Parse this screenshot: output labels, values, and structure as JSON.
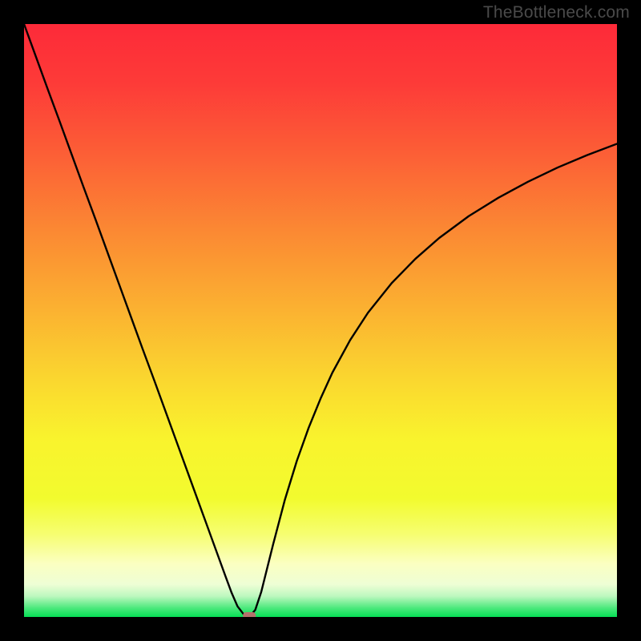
{
  "watermark": "TheBottleneck.com",
  "chart_data": {
    "type": "line",
    "title": "",
    "xlabel": "",
    "ylabel": "",
    "x_range": [
      0,
      100
    ],
    "y_range": [
      0,
      100
    ],
    "minimum_x": 38,
    "marker": {
      "x": 38,
      "y": 0,
      "color": "#b4726c"
    },
    "series": [
      {
        "name": "bottleneck-curve",
        "color": "#000000",
        "x": [
          0,
          2,
          4,
          6,
          8,
          10,
          12,
          14,
          16,
          18,
          20,
          22,
          24,
          26,
          28,
          30,
          32,
          34,
          35,
          36,
          37,
          38,
          39,
          40,
          42,
          44,
          46,
          48,
          50,
          52,
          55,
          58,
          62,
          66,
          70,
          75,
          80,
          85,
          90,
          95,
          100
        ],
        "y": [
          100,
          94.5,
          89,
          83.6,
          78.1,
          72.6,
          67.2,
          61.7,
          56.2,
          50.7,
          45.2,
          39.8,
          34.3,
          28.8,
          23.3,
          17.8,
          12.3,
          6.8,
          4.1,
          1.8,
          0.5,
          0,
          1.2,
          4.2,
          12.2,
          19.8,
          26.3,
          31.9,
          36.8,
          41.2,
          46.7,
          51.3,
          56.3,
          60.4,
          63.9,
          67.6,
          70.7,
          73.4,
          75.8,
          77.9,
          79.8
        ]
      }
    ],
    "background_gradient": {
      "stops": [
        {
          "offset": 0.0,
          "color": "#fd2a39"
        },
        {
          "offset": 0.1,
          "color": "#fd3b38"
        },
        {
          "offset": 0.22,
          "color": "#fc5f36"
        },
        {
          "offset": 0.35,
          "color": "#fb8933"
        },
        {
          "offset": 0.48,
          "color": "#fbb131"
        },
        {
          "offset": 0.6,
          "color": "#fad72f"
        },
        {
          "offset": 0.7,
          "color": "#f9f32d"
        },
        {
          "offset": 0.8,
          "color": "#f2fb2e"
        },
        {
          "offset": 0.86,
          "color": "#f6fe70"
        },
        {
          "offset": 0.91,
          "color": "#fbffc1"
        },
        {
          "offset": 0.945,
          "color": "#eefed5"
        },
        {
          "offset": 0.965,
          "color": "#bdf8bf"
        },
        {
          "offset": 0.985,
          "color": "#4be97c"
        },
        {
          "offset": 1.0,
          "color": "#06df55"
        }
      ]
    }
  }
}
